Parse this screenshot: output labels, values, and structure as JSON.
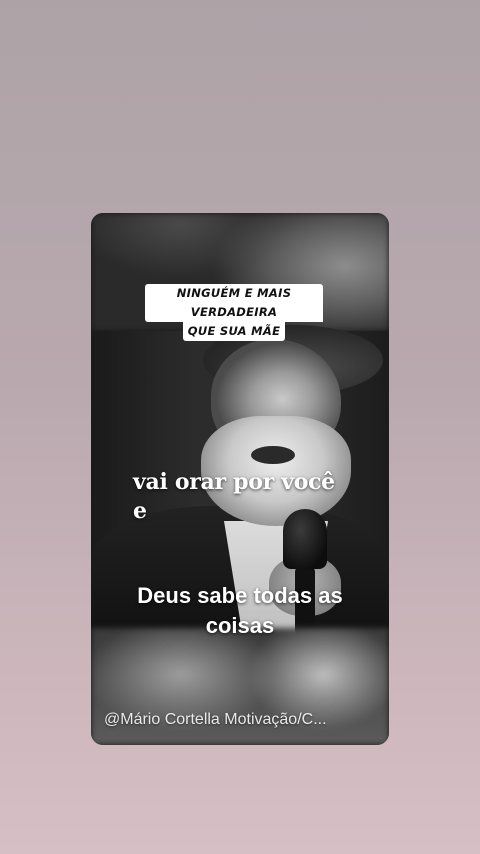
{
  "story": {
    "caption_tag": {
      "line1": "NINGUÉM E MAIS VERDADEIRA",
      "line2": "QUE SUA MÃE"
    },
    "subtitle_1": {
      "line1": "vai orar por você",
      "line2": "e"
    },
    "subtitle_2": {
      "line1": "Deus sabe todas as",
      "line2": "coisas"
    },
    "watermark": "@Mário Cortella Motivação/C..."
  },
  "colors": {
    "background_top": "#ada3a7",
    "background_bottom": "#d6bfc5",
    "caption_bg": "#ffffff",
    "caption_text": "#111111",
    "subtitle_text": "#ffffff"
  }
}
